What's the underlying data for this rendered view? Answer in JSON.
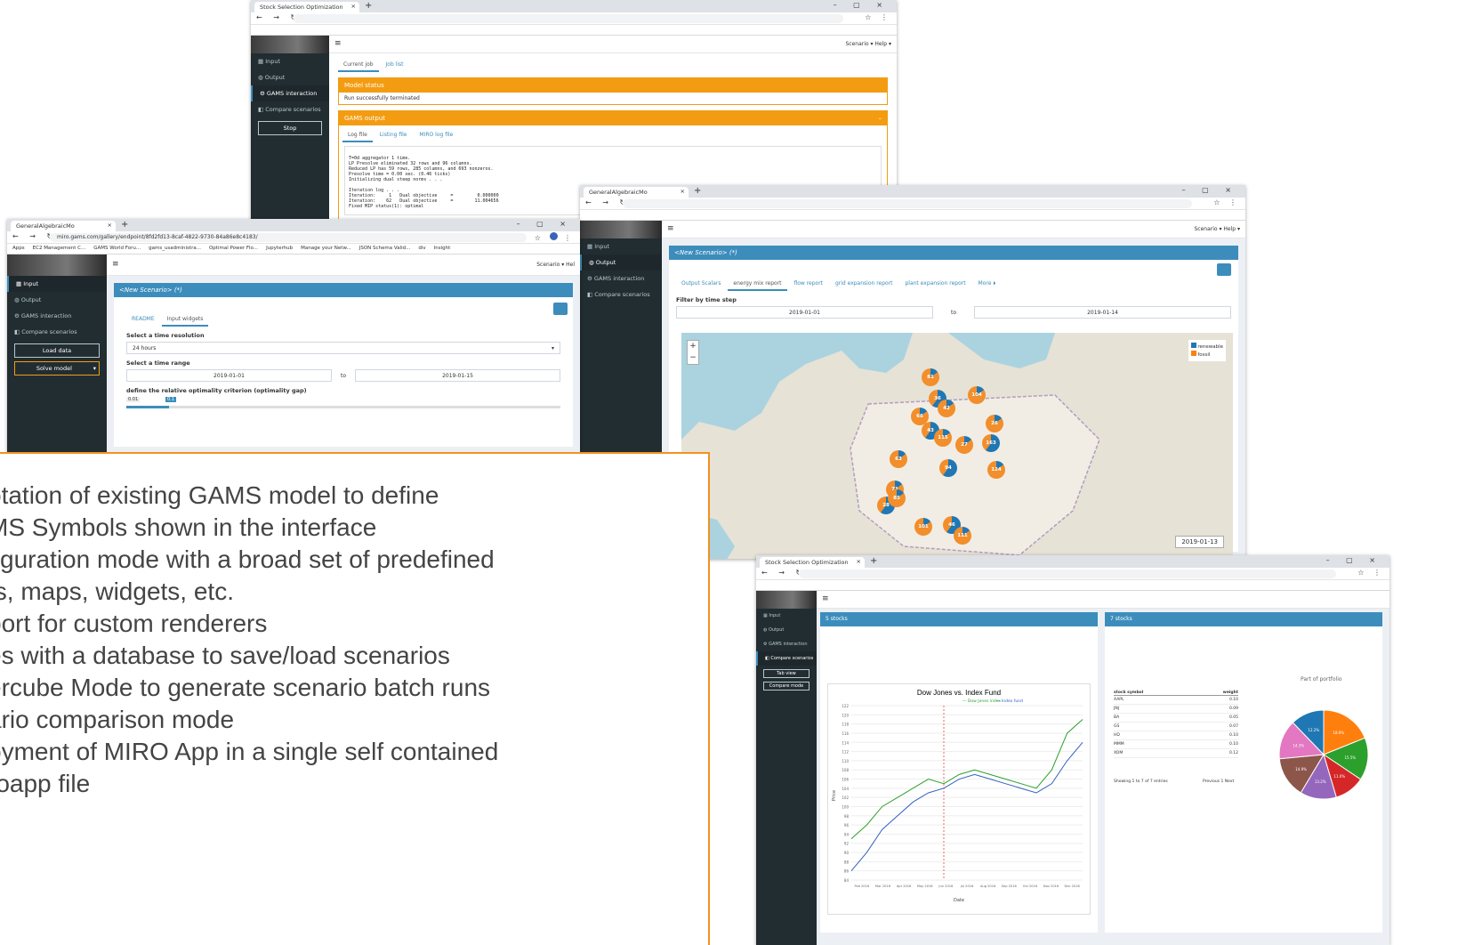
{
  "caption": {
    "lines": [
      "otation of existing GAMS model to define",
      "MS Symbols shown in the interface",
      "figuration mode with a broad set of predefined",
      "ts, maps, widgets, etc.",
      "port for custom renderers",
      "es with a database to save/load scenarios",
      "ercube Mode to generate scenario batch runs",
      "ario comparison mode",
      "oyment of MIRO App in a single self contained",
      "roapp file"
    ]
  },
  "shot1": {
    "tab_title": "Stock Selection Optimization",
    "sidebar": [
      "Input",
      "Output",
      "GAMS interaction",
      "Compare scenarios"
    ],
    "stop_label": "Stop",
    "topnav": "Scenario ▾   Help ▾",
    "tabs": [
      "Current job",
      "Job list"
    ],
    "model_status_title": "Model status",
    "model_status_text": "Run successfully terminated",
    "gams_output_title": "GAMS output",
    "output_tabs": [
      "Log file",
      "Listing file",
      "MIRO log file"
    ],
    "log": "T=0d aggregator 1 time.\nLP Presolve eliminated 32 rows and 96 columns.\nReduced LP has 59 rows, 285 columns, and 693 nonzeros.\nPresolve time = 0.00 sec. (0.46 ticks)\nInitializing dual steep norms . . .\n\nIteration log . . .\nIteration:     1   Dual objective     =         0.000000\nIteration:    62   Dual objective     =        11.004656\nFixed MIP status(1): optimal"
  },
  "shot2": {
    "tab_title": "GeneralAlgebraicMo",
    "url": "miro.gams.com/gallery/endpoint/8fd2fd13-8caf-4822-9730-84a86e8c4183/",
    "bookmarks": [
      "Apps",
      "EC2 Management C...",
      "GAMS World Foru...",
      "gams_usadministra...",
      "Optimal Power Flo...",
      "Jupyterhub",
      "Manage your Netw...",
      "JSON Schema Valid...",
      "div",
      "Insight"
    ],
    "sidebar": [
      "Input",
      "Output",
      "GAMS interaction",
      "Compare scenarios"
    ],
    "load_label": "Load data",
    "solve_label": "Solve model",
    "topnav": "Scenario ▾   Hel",
    "box_title": "<New Scenario> (*)",
    "tabs": [
      "README",
      "Input widgets"
    ],
    "res_label": "Select a time resolution",
    "res_value": "24 hours",
    "range_label": "Select a time range",
    "range_from": "2019-01-01",
    "range_to_word": "to",
    "range_to": "2019-01-15",
    "gap_label": "define the relative optimality criterion (optimality gap)",
    "gap_min": "0.01",
    "gap_value": "0.1"
  },
  "shot3": {
    "tab_title": "GeneralAlgebraicMo",
    "sidebar": [
      "Input",
      "Output",
      "GAMS interaction",
      "Compare scenarios"
    ],
    "topnav": "Scenario ▾   Help ▾",
    "box_title": "<New Scenario> (*)",
    "tabs": [
      "Output Scalars",
      "energy mix report",
      "flow report",
      "grid expansion report",
      "plant expansion report",
      "More ⏵"
    ],
    "filter_label": "Filter by time step",
    "filter_from": "2019-01-01",
    "filter_to_word": "to",
    "filter_to": "2019-01-14",
    "legend": [
      "renewable",
      "fossil"
    ],
    "markers": [
      "81",
      "104",
      "36",
      "42",
      "66",
      "43",
      "115",
      "27",
      "163",
      "63",
      "26",
      "94",
      "124",
      "71",
      "28",
      "85",
      "101",
      "46",
      "111"
    ],
    "timestamp": "2019-01-13"
  },
  "shot4": {
    "tab_title": "Stock Selection Optimization",
    "sidebar": [
      "Input",
      "Output",
      "GAMS interaction",
      "Compare scenarios"
    ],
    "btns": [
      "Tab view",
      "Compare mode"
    ],
    "left_box": "5 stocks",
    "right_box": "7 stocks",
    "chart_title": "Dow Jones vs. Index Fund",
    "legend": [
      "Dow Jones index",
      "Index fund"
    ],
    "xlabel": "Date",
    "ylabel": "Price",
    "pie_title": "Part of portfolio",
    "table_header": [
      "stock symbol",
      "weight"
    ],
    "table_rows": [
      [
        "AAPL",
        "0.10"
      ],
      [
        "JNJ",
        "0.09"
      ],
      [
        "BA",
        "0.05"
      ],
      [
        "GS",
        "0.07"
      ],
      [
        "HD",
        "0.10"
      ],
      [
        "MMM",
        "0.10"
      ],
      [
        "XOM",
        "0.12"
      ]
    ],
    "showing": "Showing 1 to 7 of 7 entries",
    "pager": "Previous  1  Next",
    "colors": [
      "#1f77b4",
      "#ff7f0e",
      "#2ca02c",
      "#d62728",
      "#9467bd",
      "#8c564b",
      "#e377c2"
    ]
  },
  "chart_data": {
    "type": "line",
    "title": "Dow Jones vs. Index Fund",
    "xlabel": "Date",
    "ylabel": "Price",
    "x_ticks": [
      "Feb 2016",
      "Mar 2016",
      "Apr 2016",
      "May 2016",
      "Jun 2016",
      "Jul 2016",
      "Aug 2016",
      "Sep 2016",
      "Oct 2016",
      "Nov 2016",
      "Dec 2016"
    ],
    "y_ticks": [
      84,
      86,
      88,
      90,
      92,
      94,
      96,
      98,
      100,
      102,
      104,
      106,
      108,
      110,
      112,
      114,
      116,
      118,
      120,
      122
    ],
    "series": [
      {
        "name": "Dow Jones index",
        "color": "#2ca02c",
        "values": [
          93,
          96,
          100,
          102,
          104,
          106,
          105,
          107,
          108,
          107,
          106,
          105,
          104,
          108,
          116,
          119
        ]
      },
      {
        "name": "Index fund",
        "color": "#3060c0",
        "values": [
          86,
          90,
          95,
          98,
          101,
          103,
          104,
          106,
          107,
          106,
          105,
          104,
          103,
          105,
          110,
          114
        ]
      }
    ]
  },
  "pie_data": {
    "type": "pie",
    "labels": [
      "XOM",
      "HD",
      "GS",
      "BA",
      "AAPL",
      "JNJ",
      "MMM"
    ],
    "values": [
      18.9,
      15.5,
      11.0,
      13.2,
      14.9,
      14.3,
      12.2
    ]
  }
}
